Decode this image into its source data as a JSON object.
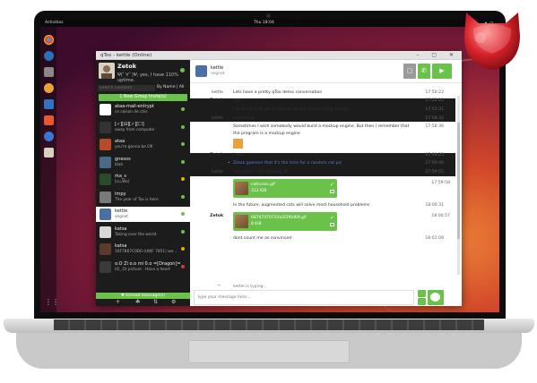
{
  "desktop": {
    "activities": "Activities",
    "clock": "Thu 18:04",
    "tray": "▾ ⏻"
  },
  "window": {
    "title": "qTox - kettle (Online)",
    "controls": "– ▢ ✕"
  },
  "profile": {
    "name": "Zetok",
    "status": "Ψ(ﾟ∀ﾟ)Ψ, yes, I have 110% uptime."
  },
  "search": {
    "placeholder": "Search contacts",
    "sort": "By Name | All"
  },
  "group_button": "1 New Group Invite(s)",
  "contacts": [
    {
      "name": "ataa-mail-entrypt",
      "status": "ce saison de chic",
      "state": "on"
    },
    {
      "name": "[✓][⊟][✓][☐]",
      "status": "away from computer",
      "state": "on"
    },
    {
      "name": "ataa",
      "status": "you're gonna be OK",
      "state": "on"
    },
    {
      "name": "gnesos",
      "status": "blah",
      "state": "on"
    },
    {
      "name": "rka_s",
      "status": "[cu,Wo]",
      "state": "away"
    },
    {
      "name": "Impy",
      "status": "The year of Tox is here",
      "state": "on"
    },
    {
      "name": "kettle",
      "status": "vegnet",
      "state": "on"
    },
    {
      "name": "katsa",
      "status": "Taking over the world.",
      "state": "on"
    },
    {
      "name": "katsa",
      "status": "10F7B67C0D0 (UWF 7851) we...",
      "state": "away"
    },
    {
      "name": "o.O Zi o.o mi 0.o =[Dragon]=",
      "status": "(ʘ‿ʘ) picture · Have a heart",
      "state": "busy"
    }
  ],
  "unread_label": "▼ Unread message(s)",
  "sidebar_actions": {
    "add": "+",
    "groups": "☘",
    "transfers": "⇅",
    "settings": "⚙"
  },
  "chat": {
    "contact_name": "kettle",
    "contact_status": "vegnet",
    "messages": [
      {
        "author": "kettle",
        "text": "Lets have a pretty qTox demo conversation",
        "time": "17:50:22",
        "kind": "msg"
      },
      {
        "author": "Zetok",
        "text": "sure",
        "time": "17:52:22",
        "kind": "me"
      },
      {
        "author": "",
        "text": "I'm afraid that you'll have to do the heavy-lifting though",
        "time": "17:52:31",
        "kind": "me2"
      },
      {
        "author": "kettle",
        "text": "mmmokay",
        "time": "17:58:32",
        "kind": "msg"
      },
      {
        "author": "",
        "text": "Sometimes I wish somebody would build a mockup engine. But then I remember that",
        "time": "17:58:36",
        "kind": "msg2"
      },
      {
        "author": "",
        "text": "the program is a mockup engine",
        "time": "",
        "kind": "msg3"
      },
      {
        "author": "",
        "text": "",
        "time": "17:59:25",
        "kind": "emoji"
      },
      {
        "author": "Zetok",
        "text": "I see",
        "time": "17:59:25",
        "kind": "me"
      },
      {
        "author": "",
        "text": "Zetok guesses that it's the time for a random cat pic",
        "time": "17:59:46",
        "kind": "action"
      },
      {
        "author": "kettle",
        "text": "just what I was thinking :9",
        "time": "17:59:55",
        "kind": "msg"
      },
      {
        "author": "",
        "text": "",
        "time": "17:59:58",
        "kind": "file1"
      },
      {
        "author": "",
        "text": "In the future, augmented cats will solve most household problems",
        "time": "18:00:31",
        "kind": "msg2"
      },
      {
        "author": "Zetok",
        "text": "",
        "time": "18:00:57",
        "kind": "file2"
      },
      {
        "author": "",
        "text": "dont count me as convinced",
        "time": "18:01:08",
        "kind": "msg2"
      }
    ],
    "file1": {
      "name": "cattunes.gif",
      "size": "312 KiB"
    },
    "file2": {
      "name": "68747470733a2f2f6d69.gif",
      "size": "8 KiB"
    },
    "typing": "kettle is typing...",
    "input_placeholder": "Type your message here..."
  },
  "colors": {
    "accent": "#6bc24a",
    "sidebar": "#1c1c1c",
    "action_text": "#5a7bd8"
  }
}
